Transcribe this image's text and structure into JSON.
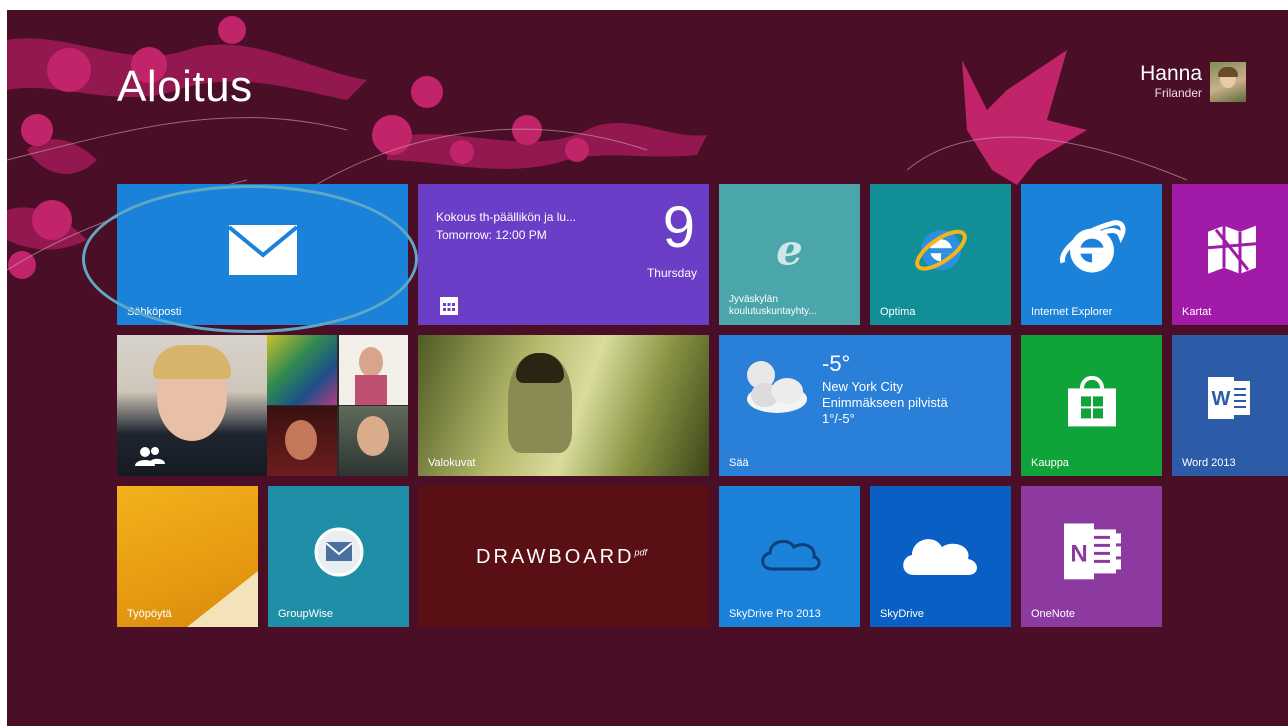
{
  "start": {
    "title": "Aloitus"
  },
  "user": {
    "first_name": "Hanna",
    "last_name": "Frilander"
  },
  "tiles": {
    "mail": {
      "label": "Sähköposti"
    },
    "calendar": {
      "event": "Kokous th-päällikön ja lu...",
      "time": "Tomorrow: 12:00 PM",
      "day_number": "9",
      "weekday": "Thursday"
    },
    "jyvaskyla": {
      "label": "Jyväskylän\nkoulutuskuntayhty..."
    },
    "optima": {
      "label": "Optima"
    },
    "ie": {
      "label": "Internet Explorer"
    },
    "kartat": {
      "label": "Kartat"
    },
    "people": {
      "label": ""
    },
    "photos": {
      "label": "Valokuvat"
    },
    "weather": {
      "label": "Sää",
      "temp": "-5°",
      "city": "New York City",
      "condition": "Enimmäkseen pilvistä",
      "range": "1°/-5°"
    },
    "kauppa": {
      "label": "Kauppa"
    },
    "word": {
      "label": "Word 2013"
    },
    "desktop": {
      "label": "Työpöytä"
    },
    "groupwise": {
      "label": "GroupWise"
    },
    "drawboard": {
      "logo": "DRAWBOARD",
      "logo_suffix": "pdf"
    },
    "skydrive_pro": {
      "label": "SkyDrive Pro 2013"
    },
    "skydrive": {
      "label": "SkyDrive"
    },
    "onenote": {
      "label": "OneNote"
    }
  },
  "colors": {
    "background": "#4a0e26",
    "accent_pink": "#c2246a",
    "highlight_ring": "#5ea8c6"
  },
  "icons": [
    "mail-icon",
    "calendar-icon",
    "ie-icon",
    "map-icon",
    "people-icon",
    "cloud-sun-icon",
    "store-icon",
    "word-icon",
    "groupwise-icon",
    "skydrive-icon",
    "onenote-icon"
  ]
}
